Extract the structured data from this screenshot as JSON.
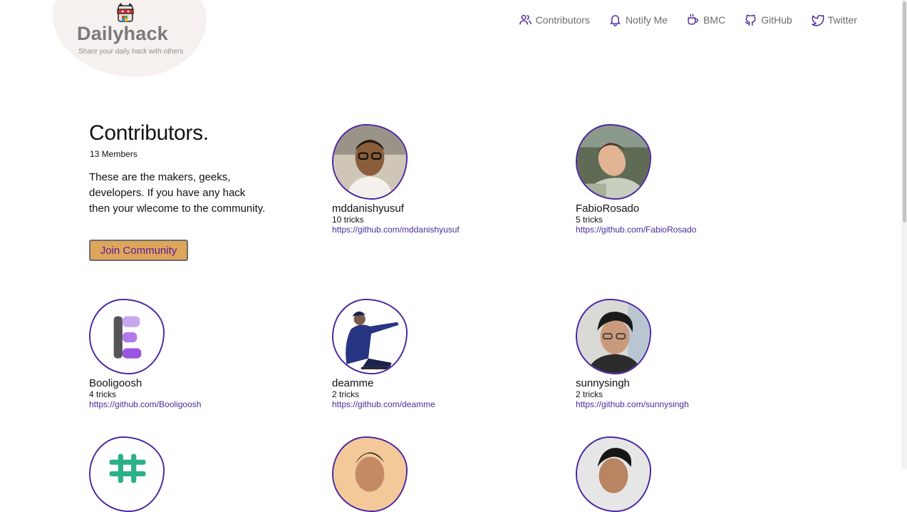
{
  "brand": {
    "title": "Dailyhack",
    "tagline": "Share your daily hack with others"
  },
  "nav": [
    {
      "label": "Contributors",
      "icon": "users-icon"
    },
    {
      "label": "Notify Me",
      "icon": "bell-icon"
    },
    {
      "label": "BMC",
      "icon": "coffee-icon"
    },
    {
      "label": "GitHub",
      "icon": "github-icon"
    },
    {
      "label": "Twitter",
      "icon": "twitter-icon"
    }
  ],
  "intro": {
    "title": "Contributors.",
    "count": "13 Members",
    "description": "These are the makers, geeks, developers. If you have any hack then your wlecome to the community.",
    "button": "Join Community"
  },
  "colors": {
    "accent": "#4b23a0",
    "button_bg": "#dda65a",
    "button_text": "#5a1b9b",
    "blob": "#f6f1ee"
  },
  "contributors": [
    {
      "name": "mddanishyusuf",
      "tricks": "10 tricks",
      "url": "https://github.com/mddanishyusuf"
    },
    {
      "name": "FabioRosado",
      "tricks": "5 tricks",
      "url": "https://github.com/FabioRosado"
    },
    {
      "name": "Booligoosh",
      "tricks": "4 tricks",
      "url": "https://github.com/Booligoosh"
    },
    {
      "name": "deamme",
      "tricks": "2 tricks",
      "url": "https://github.com/deamme"
    },
    {
      "name": "sunnysingh",
      "tricks": "2 tricks",
      "url": "https://github.com/sunnysingh"
    }
  ]
}
